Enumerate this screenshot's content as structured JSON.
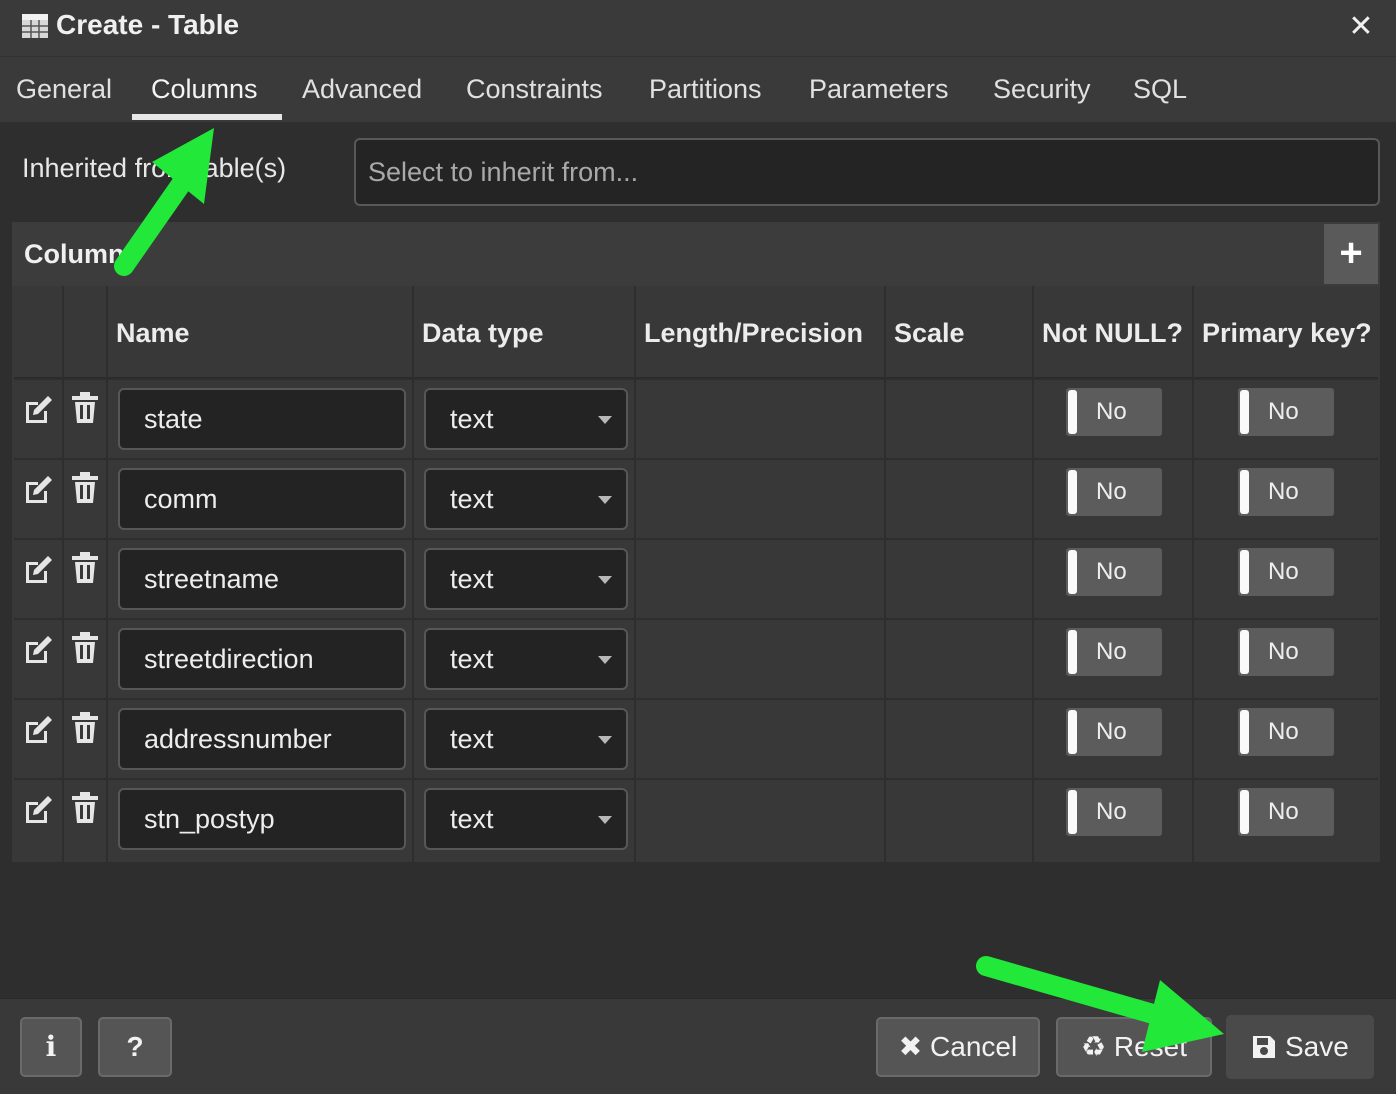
{
  "dialog": {
    "title": "Create - Table",
    "close_glyph": "✕"
  },
  "tabs": [
    {
      "label": "General"
    },
    {
      "label": "Columns"
    },
    {
      "label": "Advanced"
    },
    {
      "label": "Constraints"
    },
    {
      "label": "Partitions"
    },
    {
      "label": "Parameters"
    },
    {
      "label": "Security"
    },
    {
      "label": "SQL"
    }
  ],
  "active_tab": "Columns",
  "inherit": {
    "label": "Inherited from table(s)",
    "placeholder": "Select to inherit from..."
  },
  "columns_panel": {
    "title": "Columns",
    "add_glyph": "+",
    "headers": {
      "name": "Name",
      "data_type": "Data type",
      "length": "Length/Precision",
      "scale": "Scale",
      "not_null": "Not NULL?",
      "primary_key": "Primary key?"
    },
    "rows": [
      {
        "name": "state",
        "type": "text",
        "not_null": "No",
        "primary_key": "No"
      },
      {
        "name": "comm",
        "type": "text",
        "not_null": "No",
        "primary_key": "No"
      },
      {
        "name": "streetname",
        "type": "text",
        "not_null": "No",
        "primary_key": "No"
      },
      {
        "name": "streetdirection",
        "type": "text",
        "not_null": "No",
        "primary_key": "No"
      },
      {
        "name": "addressnumber",
        "type": "text",
        "not_null": "No",
        "primary_key": "No"
      },
      {
        "name": "stn_postyp",
        "type": "text",
        "not_null": "No",
        "primary_key": "No"
      }
    ]
  },
  "footer": {
    "info_glyph": "i",
    "help_glyph": "?",
    "cancel_label": "Cancel",
    "reset_label": "Reset",
    "save_label": "Save"
  },
  "colors": {
    "annotation_arrow": "#22e83a"
  }
}
